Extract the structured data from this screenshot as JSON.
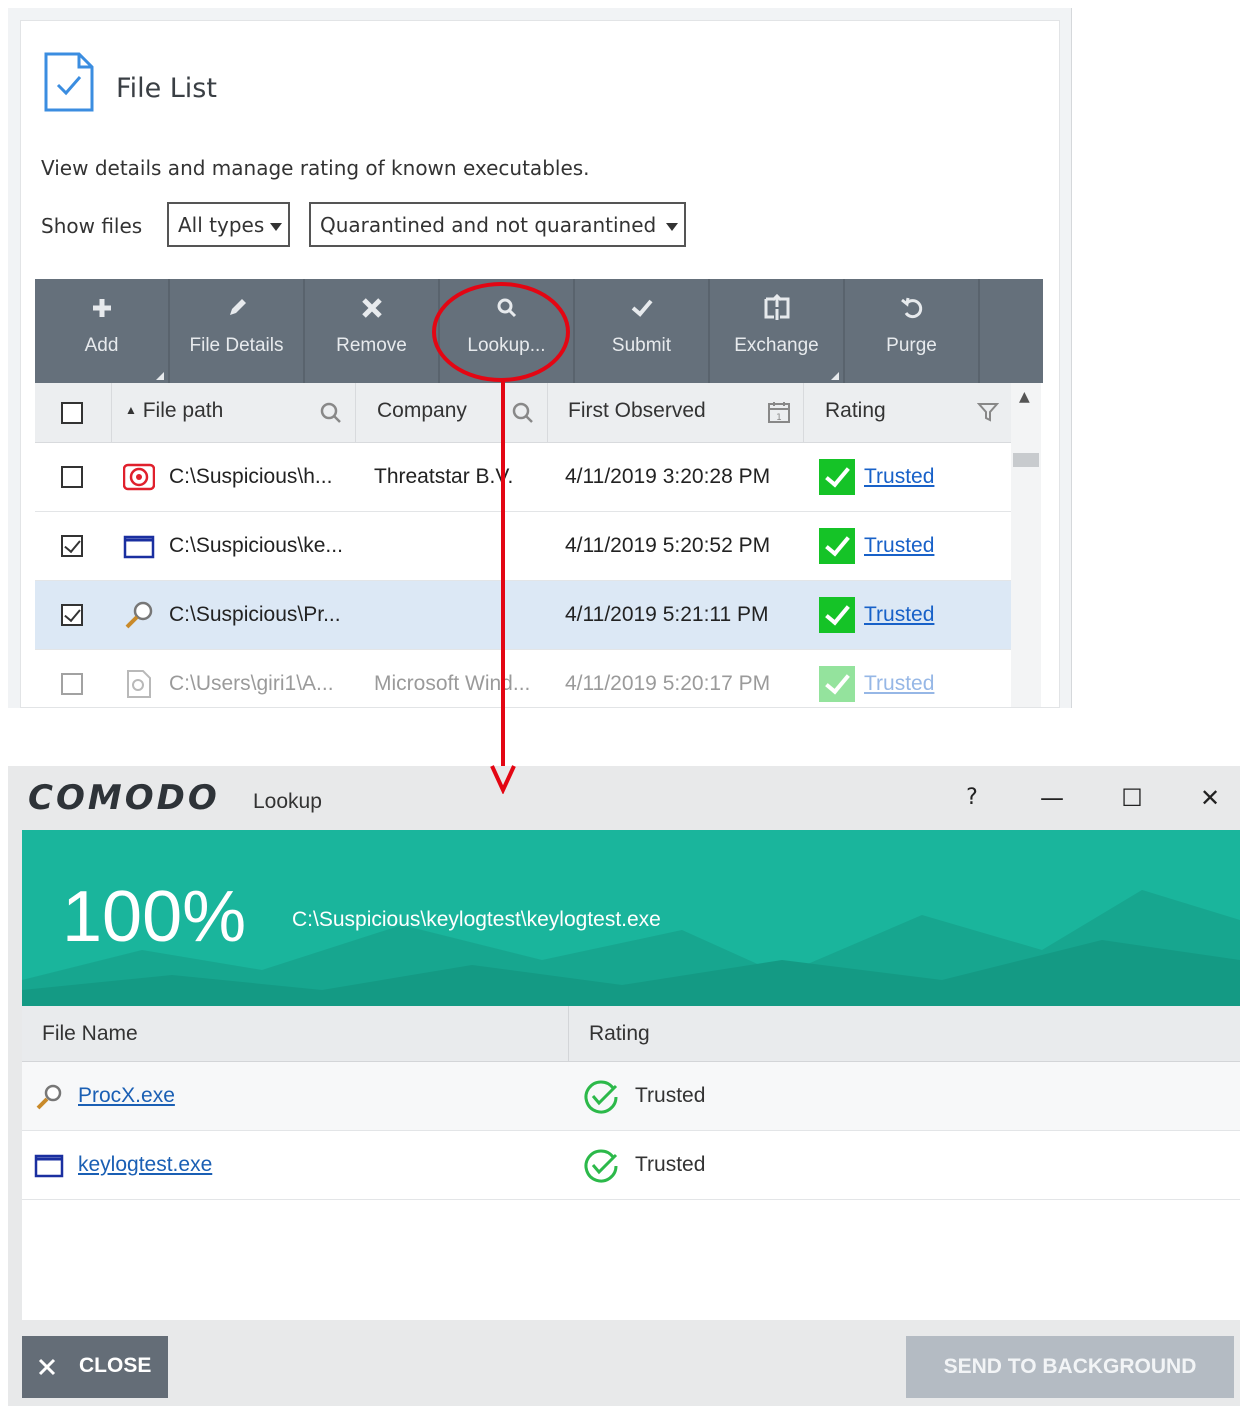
{
  "file_list": {
    "title": "File List",
    "description": "View details and manage rating of known executables.",
    "show_files_label": "Show files",
    "type_filter": "All types",
    "quarantine_filter": "Quarantined and not quarantined",
    "toolbar": {
      "add": "Add",
      "file_details": "File Details",
      "remove": "Remove",
      "lookup": "Lookup...",
      "submit": "Submit",
      "exchange": "Exchange",
      "purge": "Purge"
    },
    "columns": {
      "file_path": "File path",
      "company": "Company",
      "first_observed": "First Observed",
      "rating": "Rating"
    },
    "rows": [
      {
        "path": "C:\\Suspicious\\h...",
        "company": "Threatstar B.V.",
        "observed": "4/11/2019 3:20:28 PM",
        "rating": "Trusted",
        "checked": false
      },
      {
        "path": "C:\\Suspicious\\ke...",
        "company": "",
        "observed": "4/11/2019 5:20:52 PM",
        "rating": "Trusted",
        "checked": true
      },
      {
        "path": "C:\\Suspicious\\Pr...",
        "company": "",
        "observed": "4/11/2019 5:21:11 PM",
        "rating": "Trusted",
        "checked": true
      },
      {
        "path": "C:\\Users\\giri1\\A...",
        "company": "Microsoft Wind...",
        "observed": "4/11/2019 5:20:17 PM",
        "rating": "Trusted",
        "checked": false
      }
    ]
  },
  "lookup": {
    "brand": "COMODO",
    "title": "Lookup",
    "help": "?",
    "minimize": "—",
    "maximize": "☐",
    "close_x": "✕",
    "progress": "100%",
    "progress_value": 1.0,
    "current_path": "C:\\Suspicious\\keylogtest\\keylogtest.exe",
    "col_file_name": "File Name",
    "col_rating": "Rating",
    "results": [
      {
        "name": "ProcX.exe",
        "rating": "Trusted"
      },
      {
        "name": "keylogtest.exe",
        "rating": "Trusted"
      }
    ],
    "close_button": "CLOSE",
    "background_button": "SEND TO BACKGROUND"
  },
  "colors": {
    "toolbar": "#65707b",
    "banner": "#1ab59c",
    "annotation": "#e30613",
    "trusted_green": "#15c327"
  }
}
